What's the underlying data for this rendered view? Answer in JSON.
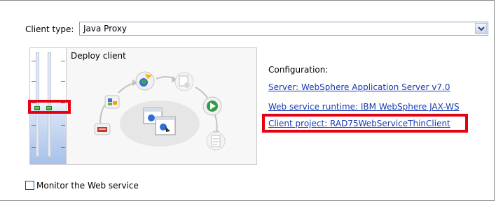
{
  "client_type": {
    "label": "Client type:",
    "value": "Java Proxy"
  },
  "deploy": {
    "title": "Deploy client",
    "slider_level": "Deploy client"
  },
  "configuration": {
    "heading": "Configuration:",
    "links": [
      "Server: WebSphere Application Server v7.0",
      "Web service runtime: IBM WebSphere JAX-WS",
      "Client project: RAD75WebServiceThinClient"
    ]
  },
  "monitor": {
    "label": "Monitor the Web service",
    "checked": false
  },
  "colors": {
    "highlight": "#e60012",
    "link": "#1a3bb3"
  }
}
